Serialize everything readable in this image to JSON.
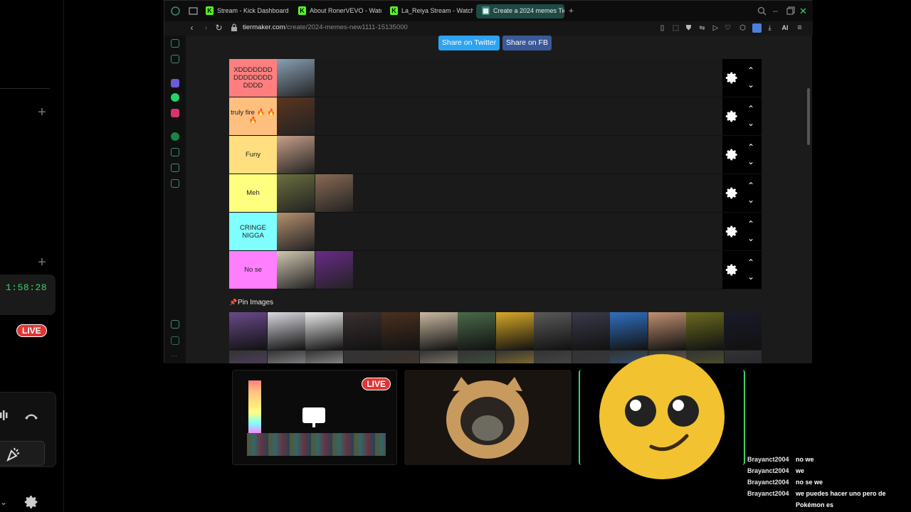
{
  "browser": {
    "tabs": [
      {
        "label": "Stream - Kick Dashboard",
        "icon": "kick-icon"
      },
      {
        "label": "About RonerVEVO - Watc",
        "icon": "kick-icon"
      },
      {
        "label": "La_Reiya Stream - Watch",
        "icon": "kick-icon"
      },
      {
        "label": "Create a 2024 memes Tie",
        "icon": "tiermaker-icon"
      }
    ],
    "url_host": "tiermaker.com",
    "url_path": "/create/2024-memes-new1111-15135000",
    "ai_label": "AI"
  },
  "share": {
    "twitter": "Share on Twitter",
    "fb": "Share on FB",
    "twitter_color": "#2ea3f2",
    "fb_color": "#3b5998"
  },
  "tiers": [
    {
      "label": "XDDDDDDD DDDDDDDD DDDD",
      "color": "#ff7f7f",
      "images": 1
    },
    {
      "label": "truly fire 🔥 🔥 🔥",
      "color": "#ffbf7f",
      "images": 1
    },
    {
      "label": "Funy",
      "color": "#ffdf7f",
      "images": 1
    },
    {
      "label": "Meh",
      "color": "#ffff7f",
      "images": 2
    },
    {
      "label": "CRINGE NIGGA",
      "color": "#7fffff",
      "images": 1
    },
    {
      "label": "No se",
      "color": "#ff7fff",
      "images": 2
    }
  ],
  "pool": {
    "label": "Pin Images"
  },
  "left_panel": {
    "timer": "1:58:28",
    "live": "LIVE"
  },
  "stream": {
    "live": "LIVE"
  },
  "chat": [
    {
      "user": "Brayanct2004",
      "msg": "no we"
    },
    {
      "user": "Brayanct2004",
      "msg": "we"
    },
    {
      "user": "Brayanct2004",
      "msg": "no se we"
    },
    {
      "user": "Brayanct2004",
      "msg": "we puedes hacer uno pero de Pokémon es"
    }
  ]
}
